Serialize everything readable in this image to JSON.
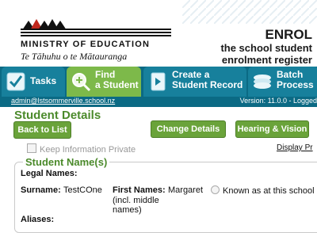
{
  "header": {
    "org_name": "MINISTRY OF EDUCATION",
    "org_maori": "Te Tāhuhu o te Mātauranga",
    "app_title": "ENROL",
    "app_subtitle_1": "the school student",
    "app_subtitle_2": "enrolment register"
  },
  "tabs": [
    {
      "label": "Tasks",
      "icon": "checklist-icon",
      "active": false
    },
    {
      "label_1": "Find",
      "label_2": "a Student",
      "icon": "magnifier-icon",
      "active": true
    },
    {
      "label_1": "Create a",
      "label_2": "Student Record",
      "icon": "document-icon",
      "active": false
    },
    {
      "label_1": "Batch",
      "label_2": "Process",
      "icon": "stack-icon",
      "active": false
    }
  ],
  "status": {
    "user_email": "admin@lstsommerville.school.nz",
    "version": "Version: 11.0.0 - Logged"
  },
  "page": {
    "title": "Student Details",
    "back_button": "Back to List",
    "change_button": "Change Details",
    "hearing_button": "Hearing & Vision",
    "keep_private_label": "Keep Information Private",
    "display_link": "Display Pr"
  },
  "student_name": {
    "section_title": "Student Name(s)",
    "legal_names_label": "Legal Names:",
    "surname_label": "Surname:",
    "surname_value": "TestCOne",
    "first_names_label": "First Names:",
    "first_names_note_1": "(incl. middle",
    "first_names_note_2": "names)",
    "first_names_value": "Margaret",
    "known_as_label": "Known as at this school",
    "aliases_label": "Aliases:"
  },
  "colors": {
    "tab_bar": "#0b6a84",
    "active_tab": "#7db94a",
    "button_green": "#6aa33a",
    "heading_green": "#4b8a2b"
  }
}
